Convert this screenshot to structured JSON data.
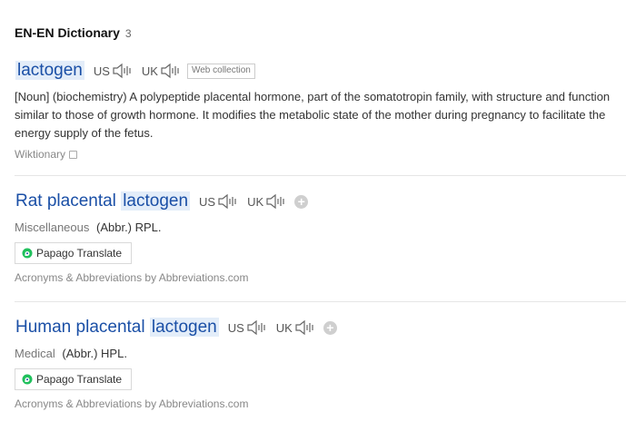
{
  "header": {
    "title": "EN-EN Dictionary",
    "count": "3"
  },
  "entries": [
    {
      "word_prefix": "",
      "word_highlight": "lactogen",
      "us_label": "US",
      "uk_label": "UK",
      "tag": "Web collection",
      "definition": "[Noun] (biochemistry) A polypeptide placental hormone, part of the somatotropin family, with structure and function similar to those of growth hormone. It modifies the metabolic state of the mother during pregnancy to facilitate the energy supply of the fetus.",
      "source": "Wiktionary"
    },
    {
      "word_prefix": "Rat placental ",
      "word_highlight": "lactogen",
      "us_label": "US",
      "uk_label": "UK",
      "category": "Miscellaneous",
      "meaning": "(Abbr.) RPL.",
      "translate_button": "Papago Translate",
      "source": "Acronyms & Abbreviations by Abbreviations.com"
    },
    {
      "word_prefix": "Human placental ",
      "word_highlight": "lactogen",
      "us_label": "US",
      "uk_label": "UK",
      "category": "Medical",
      "meaning": "(Abbr.) HPL.",
      "translate_button": "Papago Translate",
      "source": "Acronyms & Abbreviations by Abbreviations.com"
    }
  ],
  "colors": {
    "link": "#1a4fa6",
    "highlight": "#e3edf9",
    "papago_green": "#20c05c"
  },
  "icons": {
    "speaker": "speaker-icon",
    "plus": "plus-icon",
    "copy": "copy-icon",
    "papago": "papago-logo-icon"
  }
}
